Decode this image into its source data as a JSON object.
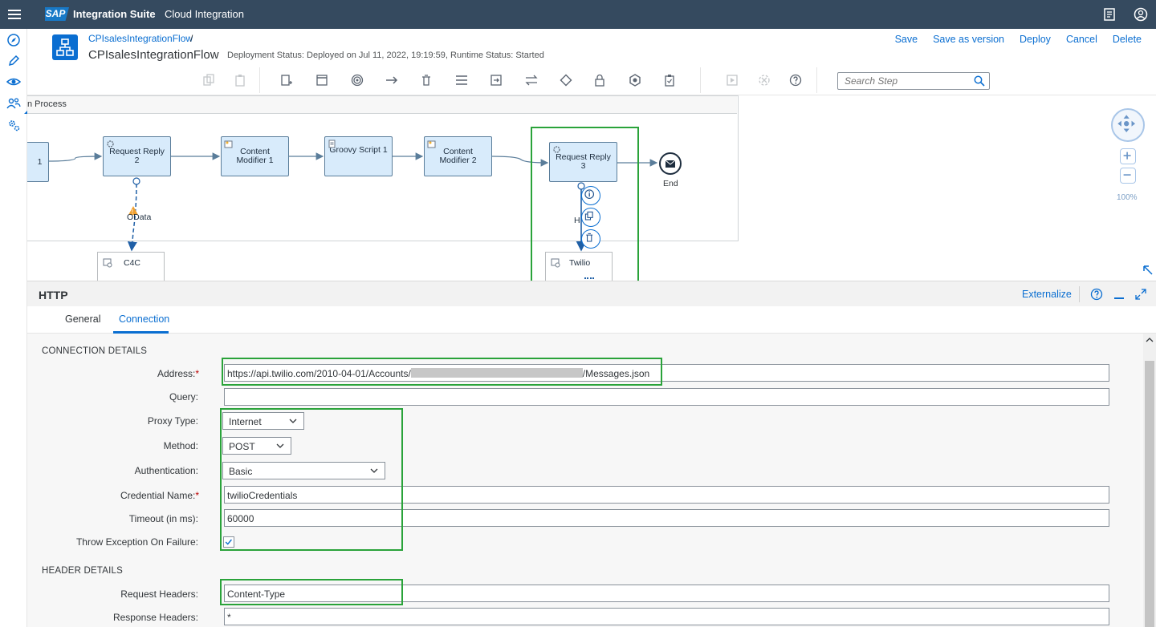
{
  "shell": {
    "logo": "SAP",
    "product": "Integration Suite",
    "section": "Cloud Integration"
  },
  "header": {
    "breadcrumb": "CPIsalesIntegrationFlow",
    "breadcrumb_sep": "/",
    "title": "CPIsalesIntegrationFlow",
    "deployment_status": "Deployment Status: Deployed on Jul 11, 2022, 19:19:59, Runtime Status: Started",
    "actions": [
      "Save",
      "Save as version",
      "Deploy",
      "Cancel",
      "Delete"
    ]
  },
  "search": {
    "placeholder": "Search Step"
  },
  "canvas": {
    "pool_label": "n Process",
    "steps": [
      {
        "label": "1"
      },
      {
        "label": "Request Reply 2"
      },
      {
        "label": "Content Modifier 1"
      },
      {
        "label": "Groovy Script 1"
      },
      {
        "label": "Content Modifier 2"
      },
      {
        "label": "Request Reply 3"
      }
    ],
    "odata_label": "OData",
    "h_label": "H",
    "receivers": [
      "C4C",
      "Twilio"
    ],
    "end_label": "End",
    "zoom": "100%"
  },
  "properties": {
    "title": "HTTP",
    "externalize": "Externalize",
    "tabs": [
      "General",
      "Connection"
    ],
    "active_tab": "Connection",
    "connection_section": "CONNECTION DETAILS",
    "header_section": "HEADER DETAILS",
    "fields": {
      "address_label": "Address:",
      "address_prefix": "https://api.twilio.com/2010-04-01/Accounts/",
      "address_suffix": "/Messages.json",
      "query_label": "Query:",
      "query_value": "",
      "proxy_label": "Proxy Type:",
      "proxy_value": "Internet",
      "method_label": "Method:",
      "method_value": "POST",
      "auth_label": "Authentication:",
      "auth_value": "Basic",
      "cred_label": "Credential Name:",
      "cred_value": "twilioCredentials",
      "timeout_label": "Timeout (in ms):",
      "timeout_value": "60000",
      "throw_label": "Throw Exception On Failure:",
      "throw_checked": true,
      "req_headers_label": "Request Headers:",
      "req_headers_value": "Content-Type",
      "resp_headers_label": "Response Headers:",
      "resp_headers_value": "*"
    }
  },
  "colors": {
    "shell": "#354a5f",
    "accent": "#0a6ed1",
    "step_fill": "#d8ebfb",
    "highlight": "#2aa33a"
  }
}
